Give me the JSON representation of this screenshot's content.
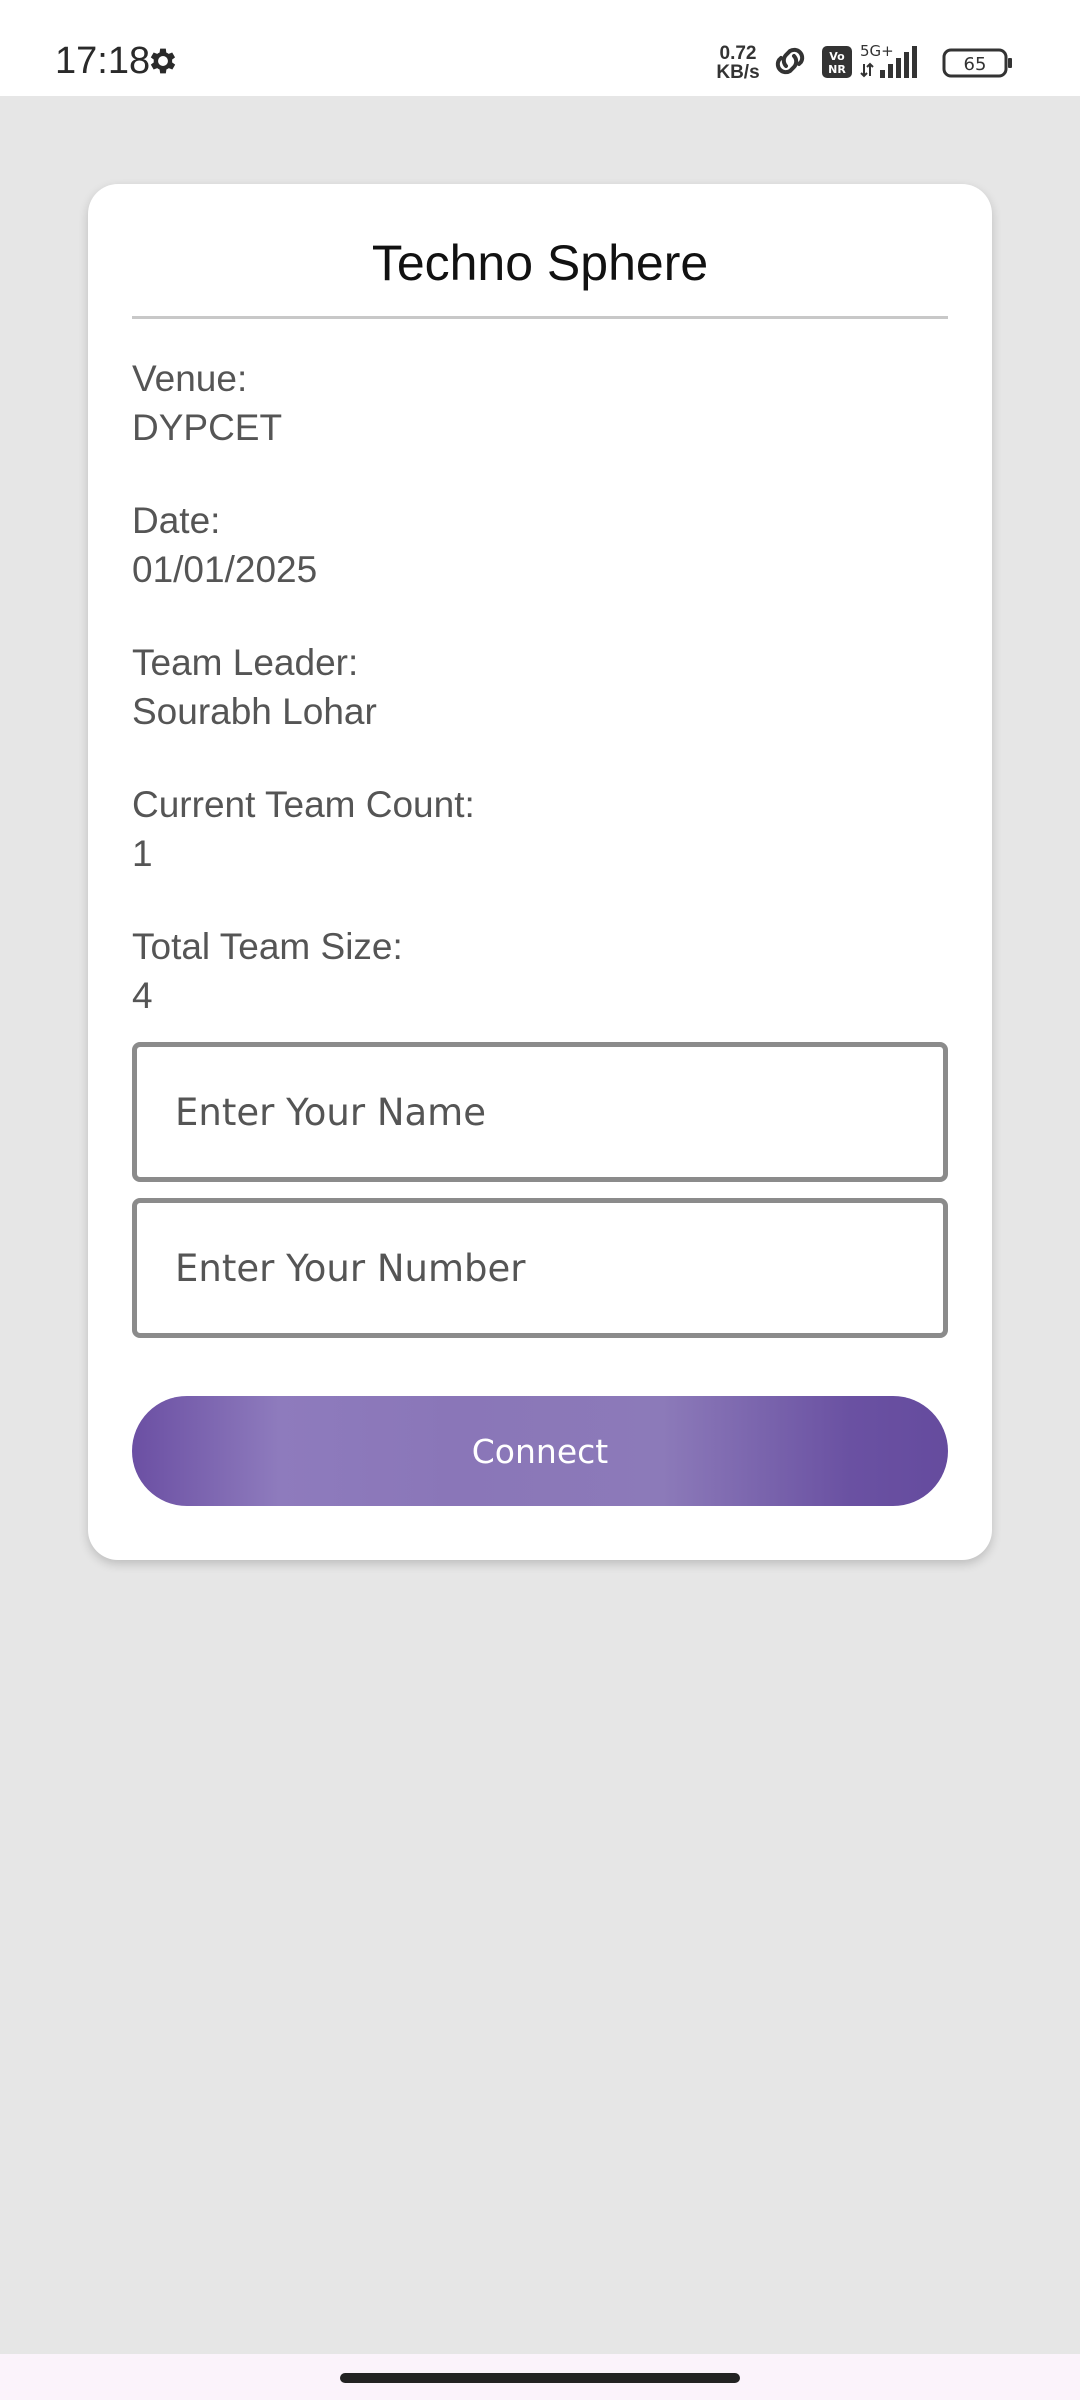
{
  "status_bar": {
    "time": "17:18",
    "net_speed_value": "0.72",
    "net_speed_unit": "KB/s",
    "network_type": "5G+",
    "volte_label": "VoNR",
    "battery_level": "65",
    "icons": [
      "gear-icon",
      "link-icon",
      "volte-icon",
      "signal-icon",
      "battery-icon"
    ]
  },
  "card": {
    "title": "Techno Sphere",
    "venue_label": "Venue:",
    "venue_value": "DYPCET",
    "date_label": "Date:",
    "date_value": "01/01/2025",
    "leader_label": "Team Leader:",
    "leader_value": "Sourabh Lohar",
    "count_label": "Current Team Count:",
    "count_value": "1",
    "size_label": "Total Team Size:",
    "size_value": "4",
    "name_placeholder": "Enter Your Name",
    "number_placeholder": "Enter Your Number",
    "connect_label": "Connect"
  },
  "colors": {
    "background": "#e6e6e6",
    "card": "#ffffff",
    "button_purple": "#6b4fa3"
  }
}
